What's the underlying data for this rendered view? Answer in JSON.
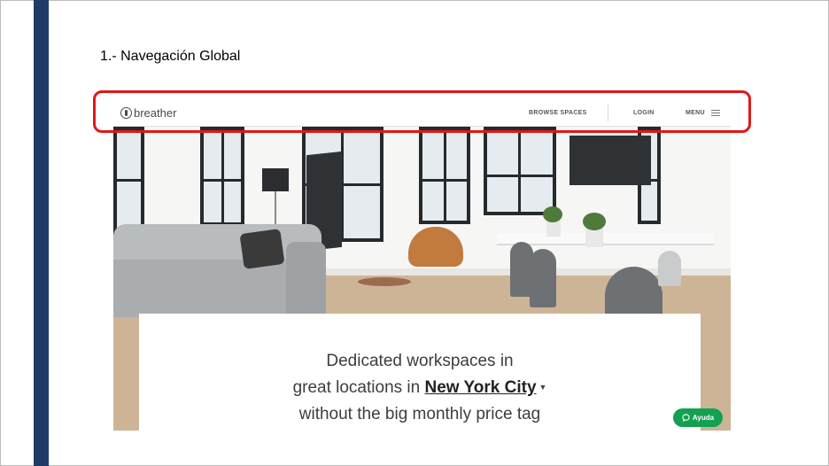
{
  "slide": {
    "title": "1.- Navegación Global",
    "accent_bar_color": "#1f3b68",
    "highlight_color": "#e01818"
  },
  "site": {
    "logo_text": "breather",
    "logo_icon": "breather-logo-icon",
    "nav": {
      "browse_label": "BROWSE SPACES",
      "login_label": "LOGIN",
      "menu_label": "MENU",
      "menu_icon": "hamburger-icon"
    },
    "hero": {
      "line1": "Dedicated workspaces in",
      "line2_prefix": "great locations in",
      "city": "New York City",
      "city_dropdown_icon": "caret-down-icon",
      "line3": "without the big monthly price tag"
    },
    "help": {
      "label": "Ayuda",
      "icon": "chat-bubble-icon",
      "color": "#12a150"
    }
  }
}
